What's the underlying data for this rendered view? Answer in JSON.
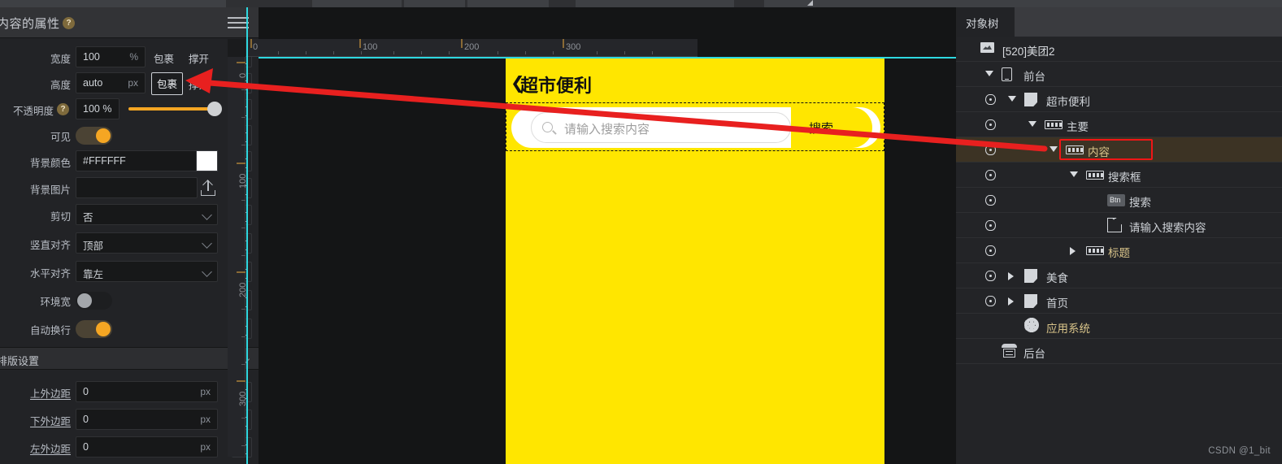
{
  "app": {
    "watermark": "CSDN @1_bit"
  },
  "left_panel": {
    "title": "内容的属性",
    "help_icon": "question-icon",
    "menu_icon": "hamburger-icon",
    "properties": [
      {
        "label": "宽度",
        "value": "100",
        "unit": "%",
        "type": "text",
        "actions": [
          "包裹",
          "撑开"
        ]
      },
      {
        "label": "高度",
        "value": "auto",
        "unit": "px",
        "type": "text",
        "actions": [
          "包裹",
          "撑开"
        ],
        "highlight_action": "包裹"
      },
      {
        "label": "不透明度",
        "value": "100 %",
        "unit": "",
        "type": "slider",
        "slider_percent": 100,
        "has_help": true
      },
      {
        "label": "可见",
        "value": "",
        "unit": "",
        "type": "toggle",
        "toggle_on": true
      },
      {
        "label": "背景颜色",
        "value": "#FFFFFF",
        "unit": "",
        "type": "color",
        "swatch": "#FFFFFF"
      },
      {
        "label": "背景图片",
        "value": "",
        "unit": "",
        "type": "upload"
      },
      {
        "label": "剪切",
        "value": "否",
        "unit": "",
        "type": "select"
      },
      {
        "label": "竖直对齐",
        "value": "顶部",
        "unit": "",
        "type": "select"
      },
      {
        "label": "水平对齐",
        "value": "靠左",
        "unit": "",
        "type": "select"
      },
      {
        "label": "环境宽",
        "value": "",
        "unit": "",
        "type": "toggle",
        "toggle_on": false
      },
      {
        "label": "自动换行",
        "value": "",
        "unit": "",
        "type": "toggle",
        "toggle_on": true
      }
    ],
    "section": {
      "title": "排版设置",
      "collapse_icon": "chevron-down-icon",
      "properties": [
        {
          "label": "上外边距",
          "value": "0",
          "unit": "px"
        },
        {
          "label": "下外边距",
          "value": "0",
          "unit": "px"
        },
        {
          "label": "左外边距",
          "value": "0",
          "unit": "px"
        }
      ]
    },
    "copy_icon": "copy-icon"
  },
  "canvas": {
    "ruler_h_labels": [
      "0",
      "100",
      "200",
      "300"
    ],
    "ruler_v_labels": [
      "0",
      "100",
      "200",
      "300"
    ],
    "guide_color": "#2ed8e0",
    "preview": {
      "background": "#FFE600",
      "back_icon": "chevron-left-icon",
      "title": "超市便利",
      "search": {
        "placeholder": "请输入搜索内容",
        "search_icon": "search-icon",
        "button_label": "搜索"
      }
    }
  },
  "right_panel": {
    "tab_label": "对象树",
    "tree": [
      {
        "label": "[520]美团2",
        "indent": 28,
        "icon": "monitor-icon",
        "eye": false,
        "arrow": "",
        "selected": false,
        "color": "#d8dbdf"
      },
      {
        "label": "前台",
        "indent": 54,
        "icon": "phone-icon",
        "eye": false,
        "arrow": "down",
        "selected": false,
        "color": "#cfd3d8"
      },
      {
        "label": "超市便利",
        "indent": 82,
        "icon": "page-icon",
        "eye": true,
        "arrow": "down",
        "selected": false,
        "color": "#cfd3d8"
      },
      {
        "label": "主要",
        "indent": 107,
        "icon": "layout-icon",
        "eye": true,
        "arrow": "down",
        "selected": false,
        "color": "#cfd3d8"
      },
      {
        "label": "内容",
        "indent": 133,
        "icon": "layout-icon",
        "eye": true,
        "arrow": "down",
        "selected": true,
        "color": "#d9c48a"
      },
      {
        "label": "搜索框",
        "indent": 158,
        "icon": "layout-icon",
        "eye": true,
        "arrow": "down",
        "selected": false,
        "color": "#cfd3d8"
      },
      {
        "label": "搜索",
        "indent": 184,
        "icon": "button-icon",
        "eye": true,
        "arrow": "",
        "selected": false,
        "color": "#cfd3d8",
        "badge": "Btn"
      },
      {
        "label": "请输入搜索内容",
        "indent": 184,
        "icon": "input-icon",
        "eye": true,
        "arrow": "",
        "selected": false,
        "color": "#cfd3d8"
      },
      {
        "label": "标题",
        "indent": 158,
        "icon": "layout-icon",
        "eye": true,
        "arrow": "right",
        "selected": false,
        "color": "#d9c48a"
      },
      {
        "label": "美食",
        "indent": 82,
        "icon": "page-icon",
        "eye": true,
        "arrow": "right",
        "selected": false,
        "color": "#cfd3d8"
      },
      {
        "label": "首页",
        "indent": 82,
        "icon": "page-icon",
        "eye": true,
        "arrow": "right",
        "selected": false,
        "color": "#cfd3d8"
      },
      {
        "label": "应用系统",
        "indent": 82,
        "icon": "gear-icon",
        "eye": false,
        "arrow": "",
        "selected": false,
        "color": "#d9c48a"
      },
      {
        "label": "后台",
        "indent": 54,
        "icon": "server-icon",
        "eye": false,
        "arrow": "",
        "selected": false,
        "color": "#cfd3d8"
      }
    ]
  },
  "annotations": {
    "red_box_target": "内容",
    "arrow_color": "#e8201f",
    "arrow_from": "内容",
    "arrow_to": "包裹"
  }
}
